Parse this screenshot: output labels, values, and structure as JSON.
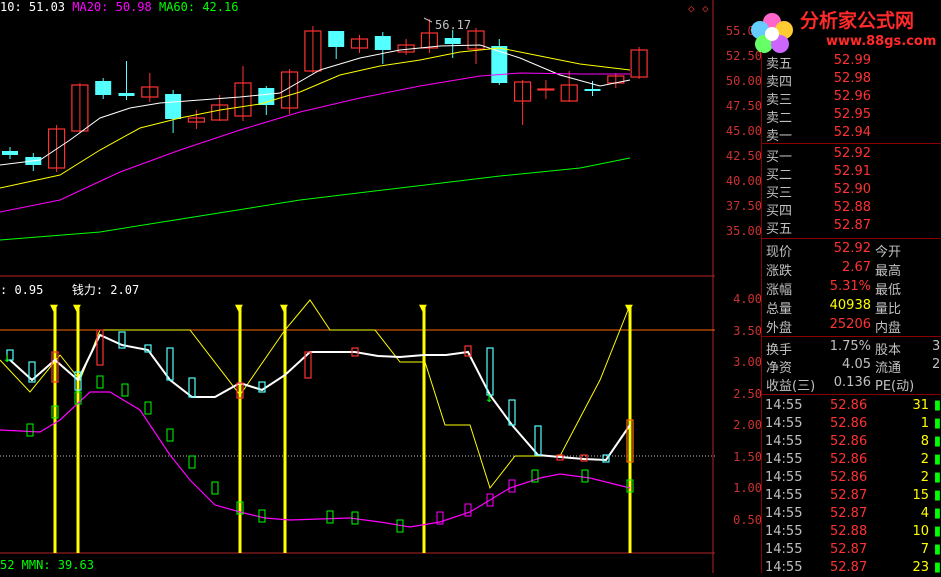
{
  "top_legend": {
    "ma10": "10: 51.03",
    "ma20": "MA20: 50.98",
    "ma60": "MA60: 42.16",
    "peak": "56.17"
  },
  "sub_legend": {
    "left": ": 0.95",
    "qianli": "钱力: 2.07",
    "mmn": "52 MMN: 39.63"
  },
  "price_axis": [
    "55.00",
    "52.50",
    "50.00",
    "47.50",
    "45.00",
    "42.50",
    "40.00",
    "37.50",
    "35.00"
  ],
  "sub_axis": [
    "4.00",
    "3.50",
    "3.00",
    "2.50",
    "2.00",
    "1.50",
    "1.00",
    "0.50"
  ],
  "logo": {
    "title": "分析家公式网",
    "url": "www.88gs.com"
  },
  "colors": {
    "up": "#ff3232",
    "down": "#54ffff",
    "ma10": "#ffffff",
    "ma20": "#ffff00",
    "ma60": "#ff00ff",
    "ma120": "#00ff00",
    "accent": "#ffff00"
  },
  "quote": {
    "asks": [
      {
        "label": "卖五",
        "value": "52.99"
      },
      {
        "label": "卖四",
        "value": "52.98"
      },
      {
        "label": "卖三",
        "value": "52.96"
      },
      {
        "label": "卖二",
        "value": "52.95"
      },
      {
        "label": "卖一",
        "value": "52.94"
      }
    ],
    "bids": [
      {
        "label": "买一",
        "value": "52.92"
      },
      {
        "label": "买二",
        "value": "52.91"
      },
      {
        "label": "买三",
        "value": "52.90"
      },
      {
        "label": "买四",
        "value": "52.88"
      },
      {
        "label": "买五",
        "value": "52.87"
      }
    ],
    "stats": [
      {
        "label": "现价",
        "value": "52.92",
        "label2": "今开",
        "color": "#ff3232"
      },
      {
        "label": "涨跌",
        "value": "2.67",
        "label2": "最高",
        "color": "#ff3232"
      },
      {
        "label": "涨幅",
        "value": "5.31%",
        "label2": "最低",
        "color": "#ff3232"
      },
      {
        "label": "总量",
        "value": "40938",
        "label2": "量比",
        "color": "#ffff00"
      },
      {
        "label": "外盘",
        "value": "25206",
        "label2": "内盘",
        "color": "#ff3232"
      }
    ],
    "stats2": [
      {
        "label": "换手",
        "value": "1.75%",
        "label2": "股本",
        "extra": "3",
        "color": "#c0c0c0"
      },
      {
        "label": "净资",
        "value": "4.05",
        "label2": "流通",
        "extra": "2",
        "color": "#c0c0c0"
      },
      {
        "label": "收益(三)",
        "value": "0.136",
        "label2": "PE(动)",
        "extra": "",
        "color": "#c0c0c0"
      }
    ],
    "ticks": [
      {
        "time": "14:55",
        "price": "52.86",
        "vol": "31",
        "c": "#ff3232"
      },
      {
        "time": "14:55",
        "price": "52.86",
        "vol": "1",
        "c": "#ff3232"
      },
      {
        "time": "14:55",
        "price": "52.86",
        "vol": "8",
        "c": "#ff3232"
      },
      {
        "time": "14:55",
        "price": "52.86",
        "vol": "2",
        "c": "#ff3232"
      },
      {
        "time": "14:55",
        "price": "52.86",
        "vol": "2",
        "c": "#ff3232"
      },
      {
        "time": "14:55",
        "price": "52.87",
        "vol": "15",
        "c": "#ff3232"
      },
      {
        "time": "14:55",
        "price": "52.87",
        "vol": "4",
        "c": "#ff3232"
      },
      {
        "time": "14:55",
        "price": "52.88",
        "vol": "10",
        "c": "#ff3232"
      },
      {
        "time": "14:55",
        "price": "52.87",
        "vol": "7",
        "c": "#ff3232"
      },
      {
        "time": "14:55",
        "price": "52.87",
        "vol": "23",
        "c": "#ff3232"
      }
    ]
  },
  "candles": [
    {
      "o": 43.0,
      "c": 42.6,
      "h": 43.4,
      "l": 42.2
    },
    {
      "o": 42.4,
      "c": 41.6,
      "h": 42.8,
      "l": 41.0
    },
    {
      "o": 41.3,
      "c": 45.2,
      "h": 45.6,
      "l": 40.9
    },
    {
      "o": 45.0,
      "c": 49.6,
      "h": 49.8,
      "l": 44.8
    },
    {
      "o": 50.0,
      "c": 48.6,
      "h": 50.3,
      "l": 48.2
    },
    {
      "o": 48.8,
      "c": 48.5,
      "h": 52.0,
      "l": 48.1
    },
    {
      "o": 48.4,
      "c": 49.4,
      "h": 50.8,
      "l": 47.9
    },
    {
      "o": 48.7,
      "c": 46.2,
      "h": 49.1,
      "l": 44.8
    },
    {
      "o": 45.9,
      "c": 46.3,
      "h": 47.1,
      "l": 45.2
    },
    {
      "o": 46.1,
      "c": 47.6,
      "h": 48.6,
      "l": 46.0
    },
    {
      "o": 46.5,
      "c": 49.8,
      "h": 51.5,
      "l": 46.0
    },
    {
      "o": 49.3,
      "c": 47.6,
      "h": 49.5,
      "l": 46.6
    },
    {
      "o": 47.3,
      "c": 50.9,
      "h": 51.2,
      "l": 46.7
    },
    {
      "o": 51.0,
      "c": 55.0,
      "h": 55.5,
      "l": 50.8
    },
    {
      "o": 55.0,
      "c": 53.4,
      "h": 55.0,
      "l": 52.2
    },
    {
      "o": 53.3,
      "c": 54.2,
      "h": 54.6,
      "l": 52.8
    },
    {
      "o": 54.5,
      "c": 53.1,
      "h": 54.9,
      "l": 51.7
    },
    {
      "o": 52.9,
      "c": 53.6,
      "h": 54.2,
      "l": 52.6
    },
    {
      "o": 53.3,
      "c": 54.8,
      "h": 56.2,
      "l": 52.8
    },
    {
      "o": 54.3,
      "c": 53.7,
      "h": 55.1,
      "l": 52.3
    },
    {
      "o": 53.2,
      "c": 55.0,
      "h": 55.3,
      "l": 51.7
    },
    {
      "o": 53.5,
      "c": 49.8,
      "h": 54.2,
      "l": 49.6
    },
    {
      "o": 48.0,
      "c": 49.9,
      "h": 50.1,
      "l": 45.6
    },
    {
      "o": 49.1,
      "c": 49.2,
      "h": 50.1,
      "l": 48.2
    },
    {
      "o": 48.0,
      "c": 49.6,
      "h": 51.0,
      "l": 47.9
    },
    {
      "o": 49.2,
      "c": 49.0,
      "h": 50.0,
      "l": 48.5
    },
    {
      "o": 49.8,
      "c": 50.5,
      "h": 50.8,
      "l": 49.3
    },
    {
      "o": 50.4,
      "c": 53.1,
      "h": 53.4,
      "l": 50.2
    }
  ]
}
